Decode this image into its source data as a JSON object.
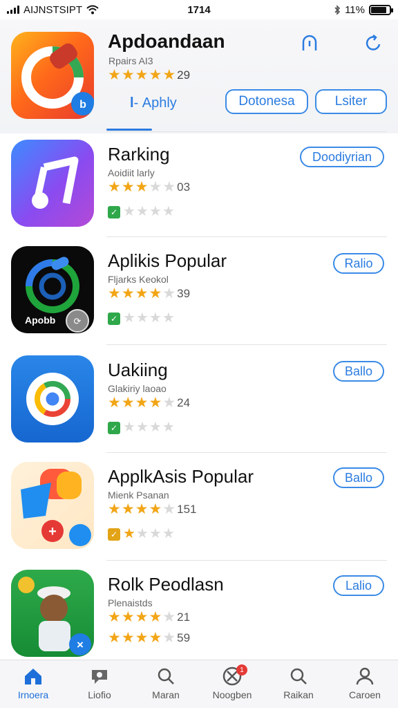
{
  "status_bar": {
    "carrier": "AIJNSTSIPT",
    "time": "1714",
    "battery": "11%",
    "battery_level": 0.85
  },
  "header": {
    "title": "Apdoandaan",
    "subtitle": "Rpairs AI3",
    "rating": 4.5,
    "rating_count": "29",
    "tab_label": "Aphly",
    "button_1": "Dotonesa",
    "button_2": "Lsiter",
    "icons": [
      "profile-icon",
      "refresh-icon"
    ]
  },
  "apps": [
    {
      "name": "Rarking",
      "subtitle": "Aoidiit larly",
      "rating": 3,
      "rating_count": "03",
      "mini_rating": 0,
      "button": "Doodiyrian",
      "icon": "music-note-icon"
    },
    {
      "name": "Aplikis Popular",
      "subtitle": "Fljarks Keokol",
      "rating": 4,
      "rating_count": "39",
      "mini_rating": 0,
      "button": "Ralio",
      "icon": "camera-lens-icon",
      "icon_text": "Apobb"
    },
    {
      "name": "Uakiing",
      "subtitle": "Glakiriy laoao",
      "rating": 4,
      "rating_count": "24",
      "mini_rating": 0,
      "button": "Ballo",
      "icon": "chrome-browser-icon"
    },
    {
      "name": "ApplkAsis Popular",
      "subtitle": "Mienk Psanan",
      "rating": 4,
      "rating_count": "151",
      "mini_rating": 1,
      "button": "Ballo",
      "icon": "colorful-apps-icon"
    },
    {
      "name": "Rolk Peodlasn",
      "subtitle": "Plenaistds",
      "rating": 4,
      "rating_count": "21",
      "rating2": 4,
      "rating2_count": "59",
      "button": "Lalio",
      "icon": "game-character-icon"
    }
  ],
  "bottom_nav": [
    {
      "label": "Irnoera",
      "icon": "home-icon",
      "active": true
    },
    {
      "label": "Liofio",
      "icon": "chat-icon",
      "active": false
    },
    {
      "label": "Maran",
      "icon": "search-icon",
      "active": false
    },
    {
      "label": "Noogben",
      "icon": "compass-icon",
      "active": false,
      "badge": "1"
    },
    {
      "label": "Raikan",
      "icon": "search-icon",
      "active": false
    },
    {
      "label": "Caroen",
      "icon": "person-icon",
      "active": false
    }
  ],
  "colors": {
    "accent": "#2a7be0",
    "star": "#f2a516"
  }
}
